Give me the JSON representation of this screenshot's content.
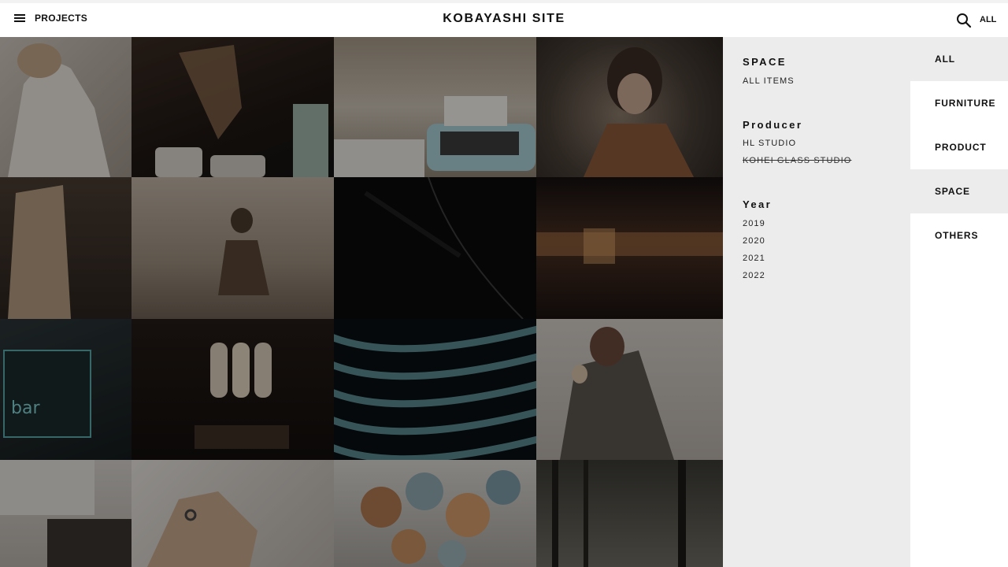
{
  "header": {
    "menu_label": "PROJECTS",
    "site_title": "KOBAYASHI SITE",
    "all_label": "ALL",
    "search_icon": "search-icon",
    "menu_icon": "hamburger-icon"
  },
  "grid": {
    "tiles": [
      {
        "name": "woman-white-shirt"
      },
      {
        "name": "coffee-pour-over"
      },
      {
        "name": "typewriter-cafe"
      },
      {
        "name": "woman-pointing"
      },
      {
        "name": "coat-fashion"
      },
      {
        "name": "desert-figure"
      },
      {
        "name": "abstract-curve"
      },
      {
        "name": "blurred-light-lines"
      },
      {
        "name": "neon-sign-bar"
      },
      {
        "name": "arched-window-room"
      },
      {
        "name": "teal-architecture"
      },
      {
        "name": "fur-coat-icecream"
      },
      {
        "name": "white-kitchen"
      },
      {
        "name": "hand-rings"
      },
      {
        "name": "paper-lanterns"
      },
      {
        "name": "forest-trees"
      }
    ]
  },
  "filter": {
    "space": {
      "heading": "SPACE",
      "items": [
        "ALL ITEMS"
      ]
    },
    "producer": {
      "heading": "Producer",
      "items": [
        "HL STUDIO",
        "KOHEI GLASS STUDIO"
      ]
    },
    "year": {
      "heading": "Year",
      "items": [
        "2019",
        "2020",
        "2021",
        "2022"
      ]
    }
  },
  "categories": [
    "ALL",
    "FURNITURE",
    "PRODUCT",
    "SPACE",
    "OTHERS"
  ],
  "colors": {
    "panel": "#ececec",
    "header_bg": "#ffffff",
    "text": "#111111"
  }
}
